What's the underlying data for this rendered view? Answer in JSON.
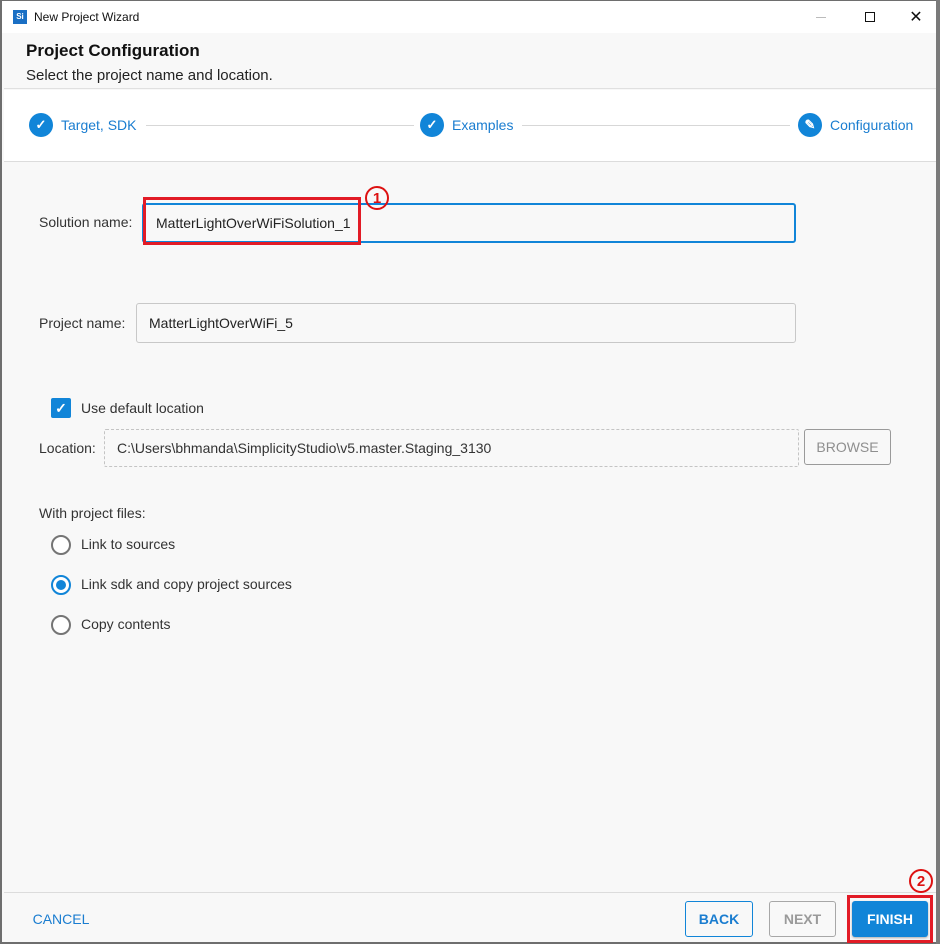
{
  "window": {
    "title": "New Project Wizard",
    "app_icon": "Si",
    "controls": {
      "minimize": "minimize-icon",
      "maximize": "maximize-icon",
      "close": "✕"
    }
  },
  "header": {
    "title": "Project Configuration",
    "subtitle": "Select the project name and location."
  },
  "stepper": {
    "steps": [
      {
        "label": "Target, SDK",
        "state": "complete",
        "icon": "✓"
      },
      {
        "label": "Examples",
        "state": "complete",
        "icon": "✓"
      },
      {
        "label": "Configuration",
        "state": "active",
        "icon": "✎"
      }
    ]
  },
  "form": {
    "solution_name": {
      "label": "Solution name:",
      "value": "MatterLightOverWiFiSolution_1"
    },
    "project_name": {
      "label": "Project name:",
      "value": "MatterLightOverWiFi_5"
    },
    "use_default_location": {
      "label": "Use default location",
      "checked": true,
      "check_glyph": "✓"
    },
    "location": {
      "label": "Location:",
      "value": "C:\\Users\\bhmanda\\SimplicityStudio\\v5.master.Staging_3130"
    },
    "browse_label": "BROWSE",
    "project_files": {
      "label": "With project files:",
      "options": [
        {
          "label": "Link to sources",
          "selected": false
        },
        {
          "label": "Link sdk and copy project sources",
          "selected": true
        },
        {
          "label": "Copy contents",
          "selected": false
        }
      ]
    }
  },
  "annotations": [
    {
      "number": "1",
      "target": "solution-name-field"
    },
    {
      "number": "2",
      "target": "finish-button"
    }
  ],
  "footer": {
    "cancel": "CANCEL",
    "back": "BACK",
    "next": "NEXT",
    "finish": "FINISH"
  },
  "colors": {
    "accent": "#1185d8",
    "annotation": "#e21b26"
  }
}
